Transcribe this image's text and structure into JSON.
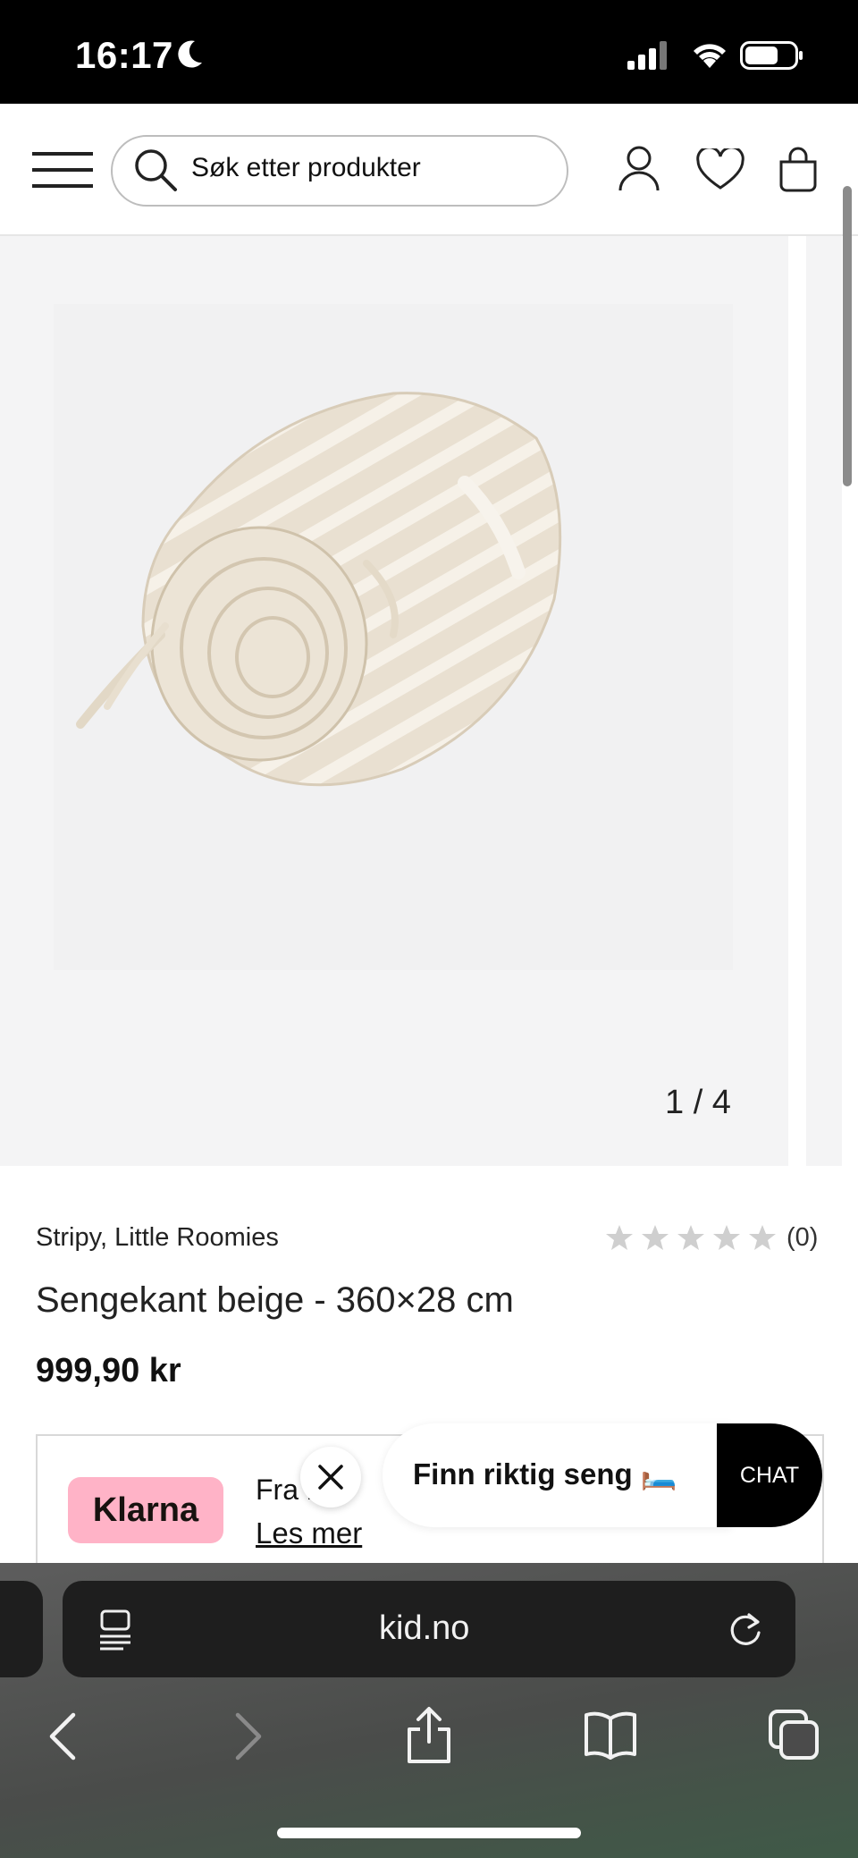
{
  "status_bar": {
    "time": "16:17"
  },
  "header": {
    "search_placeholder": "Søk etter produkter"
  },
  "gallery": {
    "counter": "1 / 4"
  },
  "product": {
    "brand": "Stripy, Little Roomies",
    "rating_count": "(0)",
    "rating": 0,
    "rating_max": 5,
    "title": "Sengekant beige - 360×28 cm",
    "price": "999,90 kr"
  },
  "klarna": {
    "logo_text": "Klarna",
    "text": "Fra    k",
    "link": "Les mer"
  },
  "chat": {
    "bubble_text": "Finn riktig seng 🛏️",
    "button_label": "CHAT"
  },
  "browser": {
    "url": "kid.no"
  },
  "colors": {
    "klarna_pink": "#ffb3c7",
    "chat_button": "#000000",
    "status_bar": "#000000"
  }
}
